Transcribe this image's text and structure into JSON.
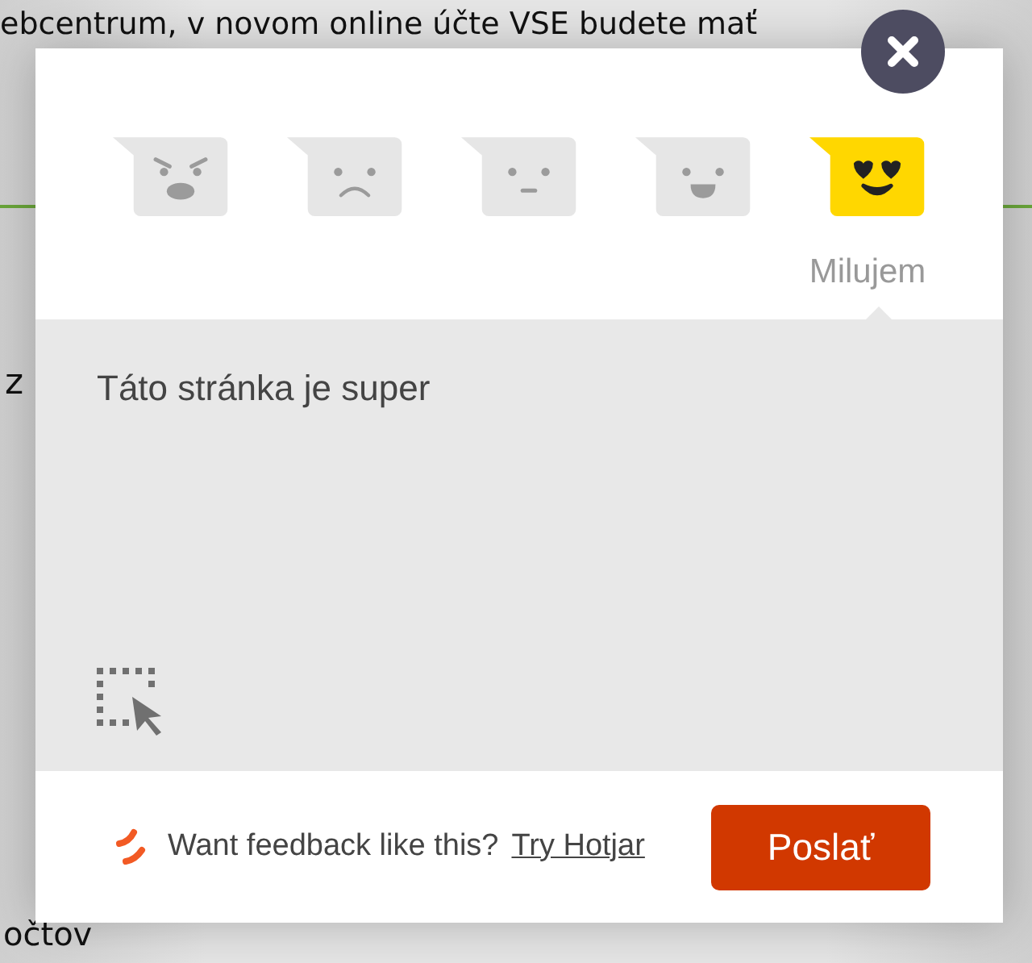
{
  "page": {
    "texts": [
      "ebcentrum, v novom online účte VSE budete mať",
      "z",
      "očtov"
    ]
  },
  "feedback": {
    "ratings": [
      {
        "kind": "angry",
        "selected": false
      },
      {
        "kind": "sad",
        "selected": false
      },
      {
        "kind": "neutral",
        "selected": false
      },
      {
        "kind": "happy",
        "selected": false
      },
      {
        "kind": "love",
        "selected": true,
        "label": "Milujem"
      }
    ],
    "comment": "Táto stránka je super",
    "footer": {
      "text": "Want feedback like this?",
      "link": "Try Hotjar"
    },
    "submit": "Poslať"
  }
}
